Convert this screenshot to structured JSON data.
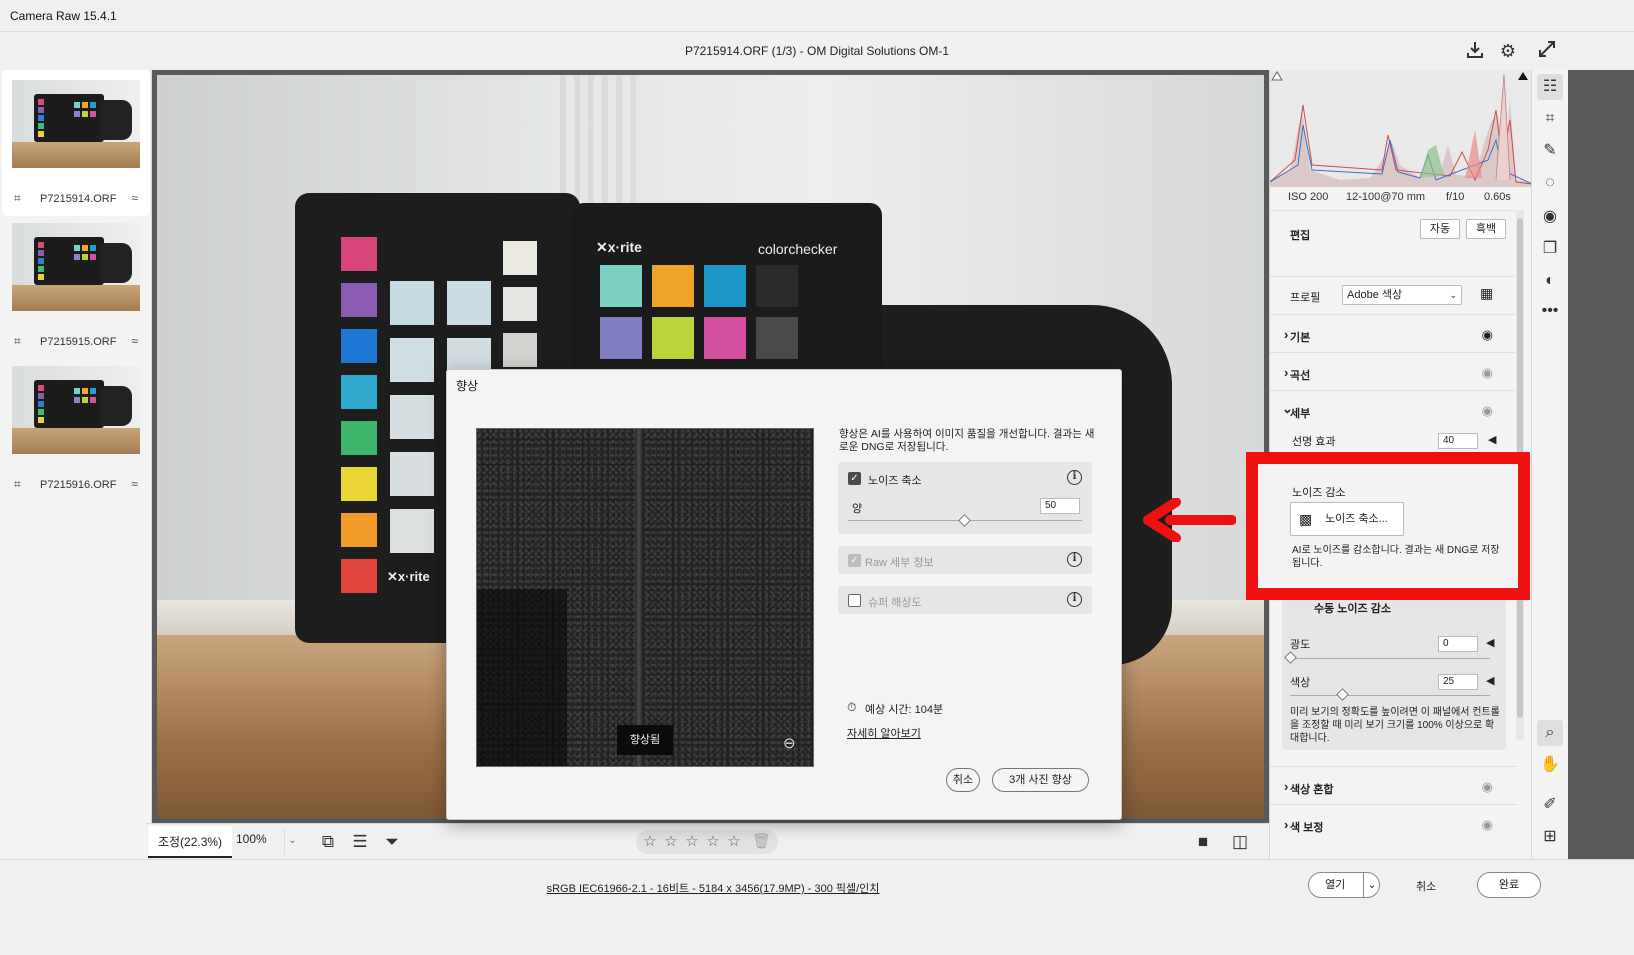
{
  "window": {
    "app_title": "Camera Raw 15.4.1",
    "doc_title": "P7215914.ORF (1/3)  -  OM Digital Solutions OM-1"
  },
  "filmstrip": [
    {
      "name": "P7215914.ORF",
      "selected": true
    },
    {
      "name": "P7215915.ORF",
      "selected": false
    },
    {
      "name": "P7215916.ORF",
      "selected": false
    }
  ],
  "viewbar": {
    "fit_label": "조정(22.3%)",
    "zoom": "100%"
  },
  "status": {
    "info": "sRGB IEC61966-2.1 - 16비트 - 5184 x 3456(17.9MP) - 300 픽셀/인치",
    "open": "열기",
    "cancel": "취소",
    "done": "완료"
  },
  "panel": {
    "exif": {
      "iso": "ISO 200",
      "lens": "12-100@70 mm",
      "aperture": "f/10",
      "shutter": "0.60s"
    },
    "edit_label": "편집",
    "auto": "자동",
    "bw": "흑백",
    "profile_label": "프로필",
    "profile_value": "Adobe 색상",
    "sections": {
      "basic": "기본",
      "curve": "곡선",
      "detail": "세부",
      "color_mixer": "색상 혼합",
      "color_grading": "색 보정"
    },
    "sharpening": {
      "label": "선명 효과",
      "value": "40"
    },
    "noise": {
      "heading": "노이즈 감소",
      "button": "노이즈 축소...",
      "note": "AI로 노이즈를 감소합니다. 결과는 새 DNG로 저장됩니다.",
      "manual": "수동 노이즈 감소",
      "luminance": {
        "label": "광도",
        "value": "0"
      },
      "color": {
        "label": "색상",
        "value": "25"
      },
      "hint": "미리 보기의 정확도를 높이려면 이 패널에서 컨트롤을 조정할 때 미리 보기 크기를 100% 이상으로 확대합니다."
    }
  },
  "dialog": {
    "title": "향상",
    "preview_tag": "향상됨",
    "description": "향상은 AI를 사용하여 이미지 품질을 개선합니다. 결과는 새로운 DNG로 저장됩니다.",
    "denoise": {
      "label": "노이즈 축소",
      "amount_label": "양",
      "amount": "50",
      "amount_fraction": 0.5,
      "checked": true
    },
    "raw_details": {
      "label": "Raw 세부 정보",
      "enabled": false
    },
    "super_res": {
      "label": "슈퍼 해상도",
      "checked": false
    },
    "estimate": "예상 시간: 104분",
    "learn_more": "자세히 알아보기",
    "cancel": "취소",
    "enhance": "3개 사진 향상"
  },
  "colors": {
    "annotation_red": "#ee1111",
    "panel_bg": "#f3f3f3"
  }
}
